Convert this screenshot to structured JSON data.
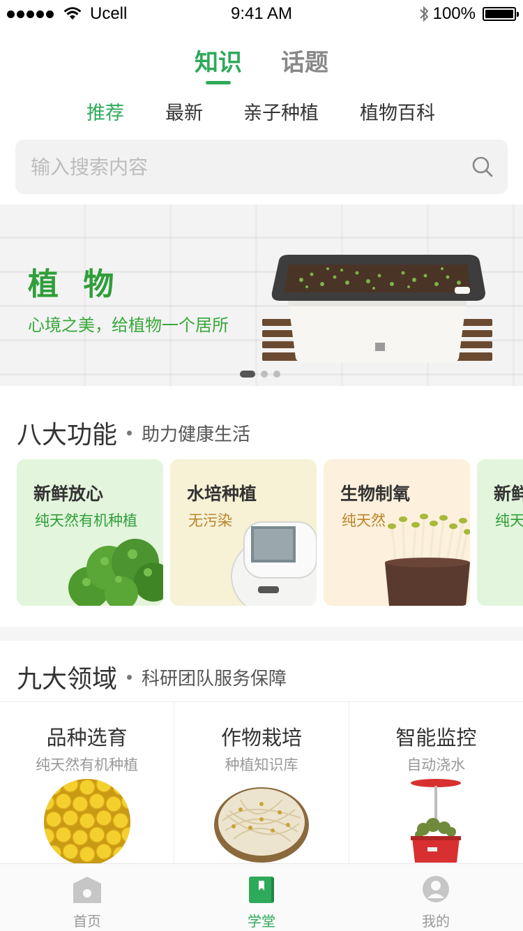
{
  "status_bar": {
    "carrier": "Ucell",
    "time": "9:41 AM",
    "battery": "100%"
  },
  "top_tabs": [
    {
      "label": "知识"
    },
    {
      "label": "话题"
    }
  ],
  "sub_tabs": [
    {
      "label": "推荐"
    },
    {
      "label": "最新"
    },
    {
      "label": "亲子种植"
    },
    {
      "label": "植物百科"
    }
  ],
  "search": {
    "placeholder": "输入搜索内容"
  },
  "banner": {
    "title": "植 物",
    "subtitle": "心境之美，给植物一个居所",
    "slide_count": 3,
    "active_slide": 1
  },
  "features": {
    "title": "八大功能",
    "subtitle": "助力健康生活",
    "cards": [
      {
        "title": "新鲜放心",
        "subtitle": "纯天然有机种植",
        "bg": "#e3f5dc",
        "sub_color": "#2f9e3a"
      },
      {
        "title": "水培种植",
        "subtitle": "无污染",
        "bg": "#f7f1d6",
        "sub_color": "#b8862b"
      },
      {
        "title": "生物制氧",
        "subtitle": "纯天然",
        "bg": "#fdf0dc",
        "sub_color": "#b8862b"
      },
      {
        "title": "新鲜",
        "subtitle": "纯天",
        "bg": "#e3f5dc",
        "sub_color": "#2f9e3a"
      }
    ]
  },
  "domains": {
    "title": "九大领域",
    "subtitle": "科研团队服务保障",
    "items": [
      {
        "title": "品种选育",
        "subtitle": "纯天然有机种植"
      },
      {
        "title": "作物栽培",
        "subtitle": "种植知识库"
      },
      {
        "title": "智能监控",
        "subtitle": "自动浇水"
      }
    ]
  },
  "tabbar": [
    {
      "label": "首页",
      "icon": "home-icon"
    },
    {
      "label": "学堂",
      "icon": "book-icon"
    },
    {
      "label": "我的",
      "icon": "profile-icon"
    }
  ],
  "colors": {
    "accent": "#2fa95a"
  }
}
